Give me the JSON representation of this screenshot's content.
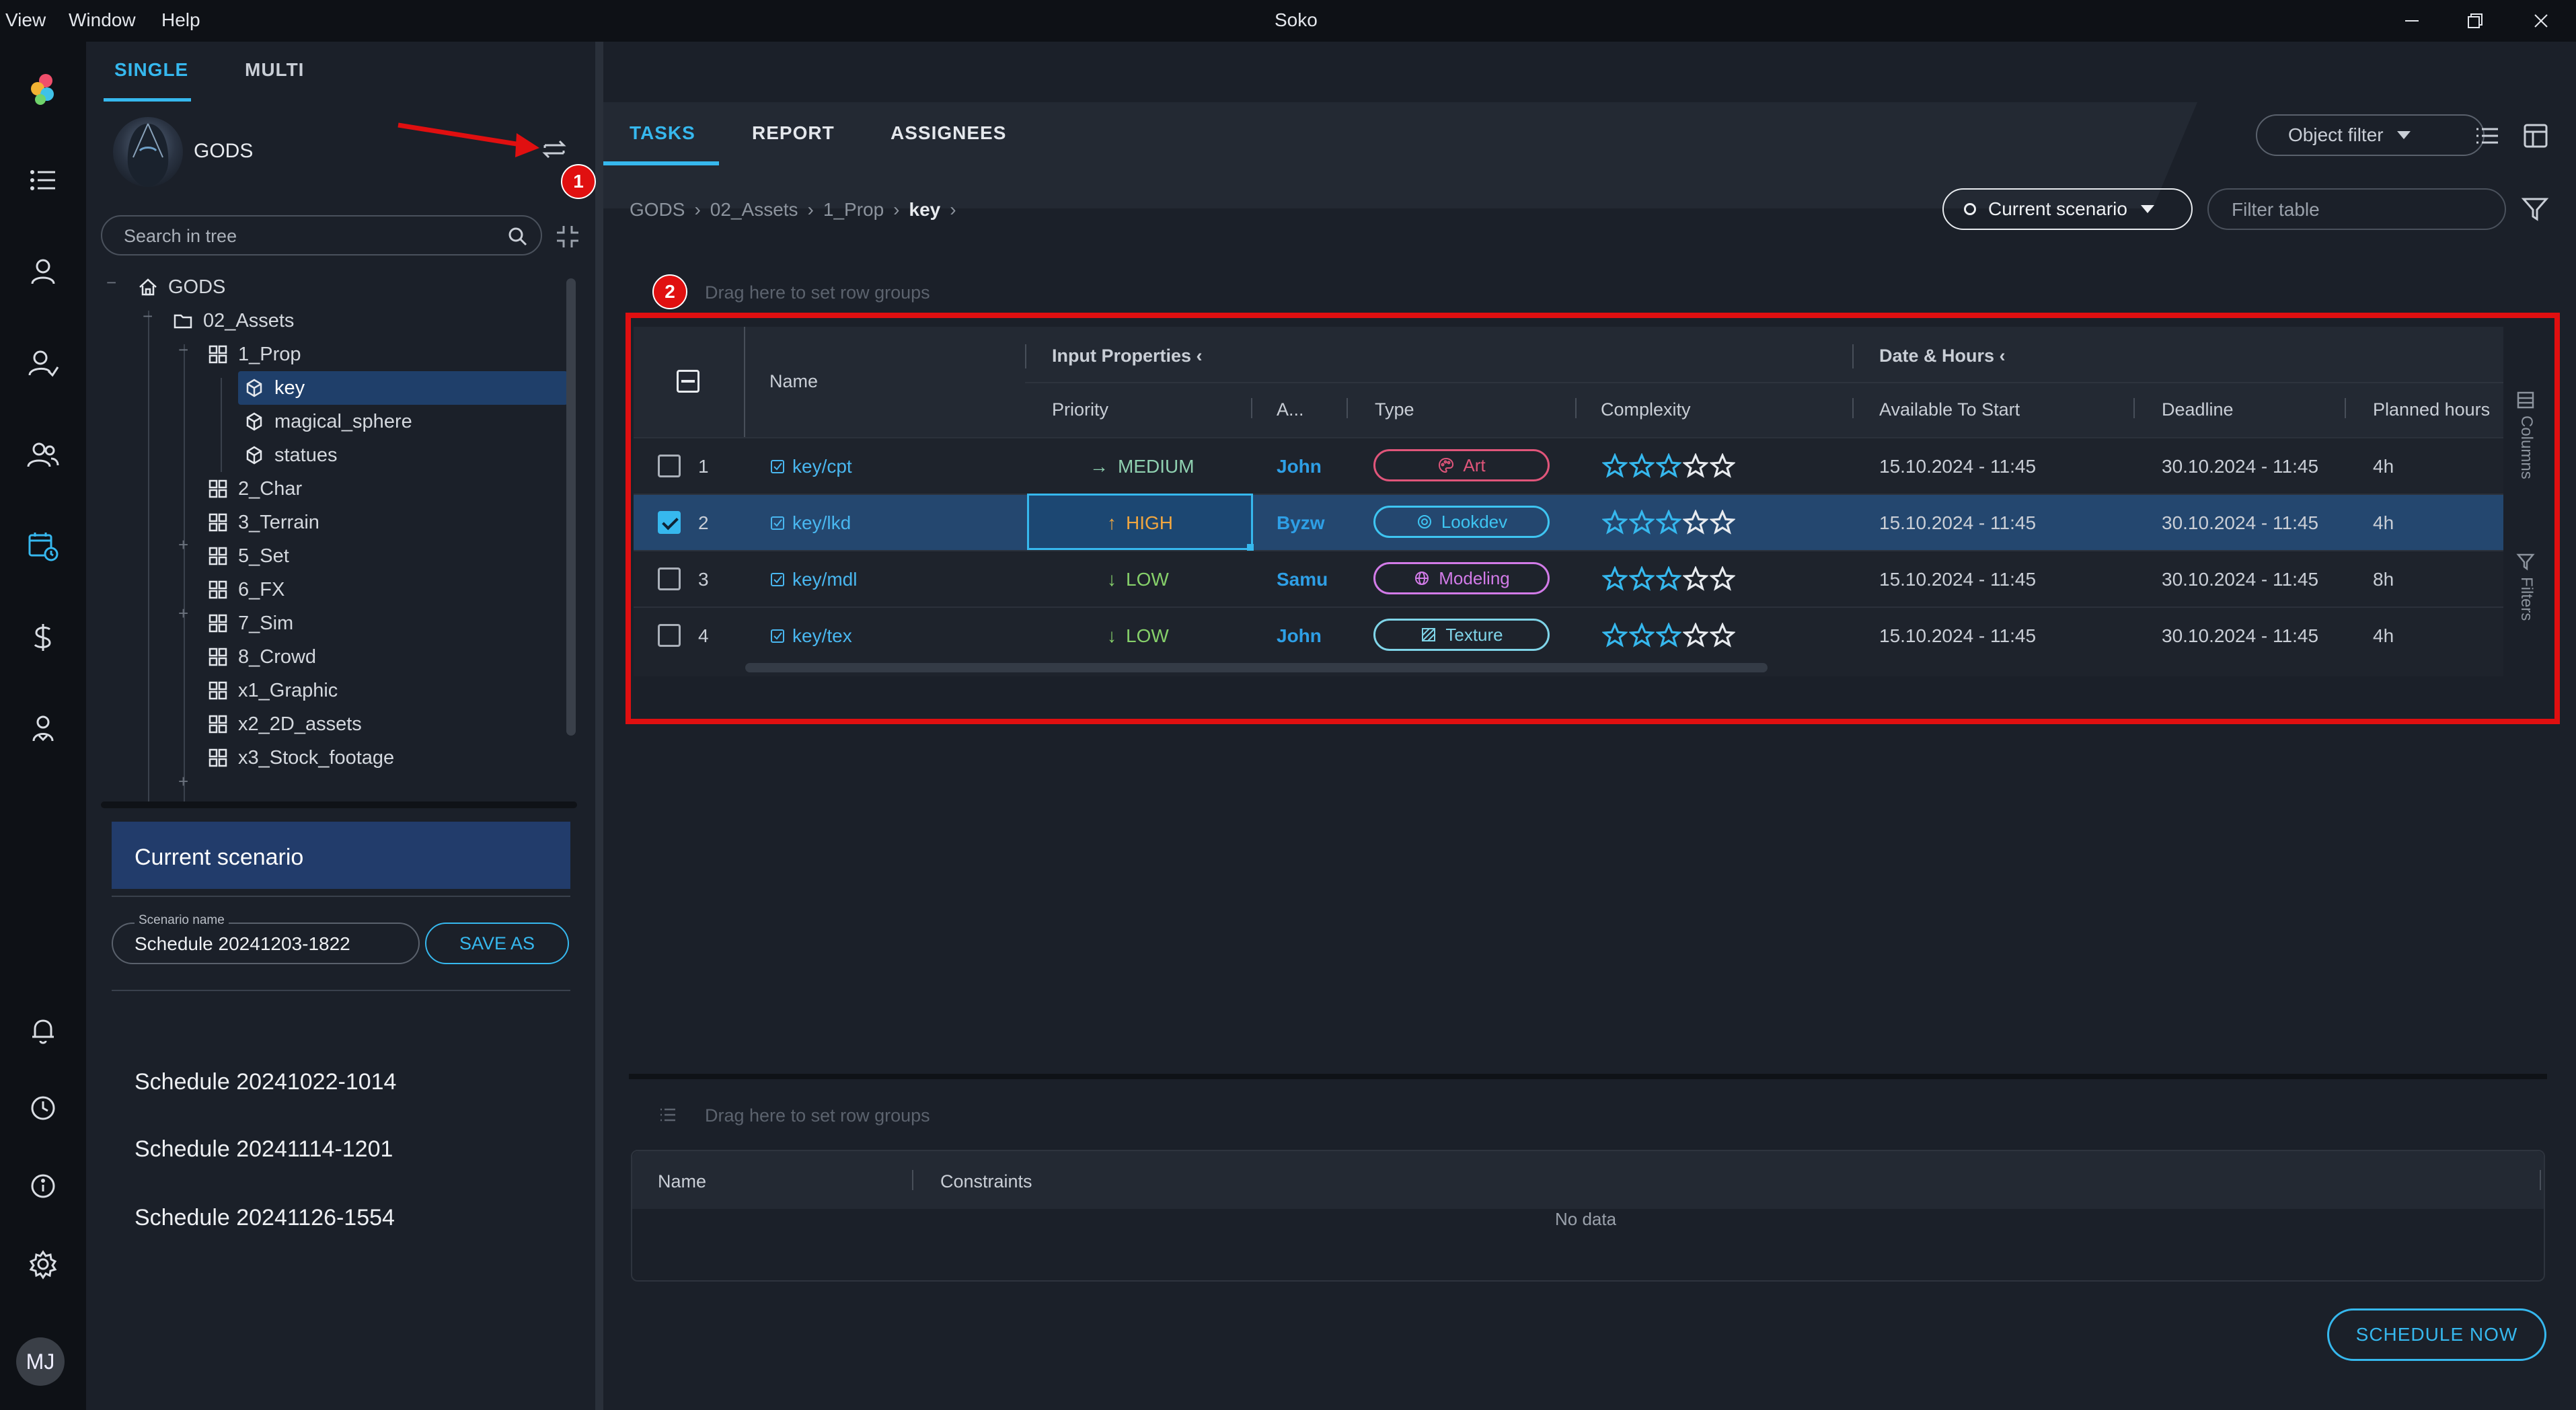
{
  "menubar": {
    "items": [
      "View",
      "Window",
      "Help"
    ],
    "title": "Soko"
  },
  "mode_tabs": {
    "single": "SINGLE",
    "multi": "MULTI"
  },
  "project": {
    "name": "GODS"
  },
  "search": {
    "placeholder": "Search in tree"
  },
  "tree": [
    {
      "label": "GODS",
      "icon": "home-icon",
      "level": 0
    },
    {
      "label": "02_Assets",
      "icon": "folder-icon",
      "level": 1
    },
    {
      "label": "1_Prop",
      "icon": "grid-icon",
      "level": 2
    },
    {
      "label": "key",
      "icon": "asset-icon",
      "level": 3,
      "selected": true
    },
    {
      "label": "magical_sphere",
      "icon": "asset-icon",
      "level": 3
    },
    {
      "label": "statues",
      "icon": "asset-icon",
      "level": 3
    },
    {
      "label": "2_Char",
      "icon": "grid-icon",
      "level": 2
    },
    {
      "label": "3_Terrain",
      "icon": "grid-icon",
      "level": 2
    },
    {
      "label": "5_Set",
      "icon": "grid-icon",
      "level": 2
    },
    {
      "label": "6_FX",
      "icon": "grid-icon",
      "level": 2
    },
    {
      "label": "7_Sim",
      "icon": "grid-icon",
      "level": 2
    },
    {
      "label": "8_Crowd",
      "icon": "grid-icon",
      "level": 2
    },
    {
      "label": "x1_Graphic",
      "icon": "grid-icon",
      "level": 2
    },
    {
      "label": "x2_2D_assets",
      "icon": "grid-icon",
      "level": 2
    },
    {
      "label": "x3_Stock_footage",
      "icon": "grid-icon",
      "level": 2
    }
  ],
  "scenario": {
    "current_label": "Current scenario",
    "name_label": "Scenario name",
    "name_value": "Schedule 20241203-1822",
    "save_as": "SAVE AS",
    "saved": [
      "Schedule 20241022-1014",
      "Schedule 20241114-1201",
      "Schedule 20241126-1554"
    ]
  },
  "main_tabs": [
    "TASKS",
    "REPORT",
    "ASSIGNEES"
  ],
  "object_filter": "Object filter",
  "breadcrumb": [
    "GODS",
    "02_Assets",
    "1_Prop",
    "key"
  ],
  "scenario_pill": "Current scenario",
  "filter_table": {
    "placeholder": "Filter table"
  },
  "drag_hint": "Drag here to set row groups",
  "badges": {
    "one": "1",
    "two": "2"
  },
  "grid": {
    "groups": {
      "input": "Input Properties",
      "date": "Date & Hours"
    },
    "columns": {
      "name": "Name",
      "priority": "Priority",
      "assignee": "A...",
      "type": "Type",
      "complexity": "Complexity",
      "available": "Available To Start",
      "deadline": "Deadline",
      "planned": "Planned hours"
    },
    "rows": [
      {
        "idx": "1",
        "name": "key/cpt",
        "priority": "MEDIUM",
        "priority_arrow": "→",
        "priority_color": "#8fd0b0",
        "assignee": "John",
        "type": "Art",
        "type_color": "#e0557a",
        "type_icon": "palette-icon",
        "complexity": 3,
        "available": "15.10.2024 - 11:45",
        "deadline": "30.10.2024 - 11:45",
        "planned": "4h",
        "checked": false
      },
      {
        "idx": "2",
        "name": "key/lkd",
        "priority": "HIGH",
        "priority_arrow": "↑",
        "priority_color": "#f0a640",
        "assignee": "Byzw",
        "type": "Lookdev",
        "type_color": "#3ec5f2",
        "type_icon": "lookdev-icon",
        "complexity": 3,
        "available": "15.10.2024 - 11:45",
        "deadline": "30.10.2024 - 11:45",
        "planned": "4h",
        "checked": true
      },
      {
        "idx": "3",
        "name": "key/mdl",
        "priority": "LOW",
        "priority_arrow": "↓",
        "priority_color": "#86d06a",
        "assignee": "Samu",
        "type": "Modeling",
        "type_color": "#d27be8",
        "type_icon": "globe-icon",
        "complexity": 3,
        "available": "15.10.2024 - 11:45",
        "deadline": "30.10.2024 - 11:45",
        "planned": "8h",
        "checked": false
      },
      {
        "idx": "4",
        "name": "key/tex",
        "priority": "LOW",
        "priority_arrow": "↓",
        "priority_color": "#86d06a",
        "assignee": "John",
        "type": "Texture",
        "type_color": "#7fd4e8",
        "type_icon": "hatch-icon",
        "complexity": 3,
        "available": "15.10.2024 - 11:45",
        "deadline": "30.10.2024 - 11:45",
        "planned": "4h",
        "checked": false
      }
    ]
  },
  "side_tools": {
    "columns": "Columns",
    "filters": "Filters"
  },
  "constraints": {
    "name_col": "Name",
    "constraints_col": "Constraints",
    "empty": "No data"
  },
  "schedule_now": "SCHEDULE NOW",
  "user_initials": "MJ",
  "colors": {
    "accent": "#36b8ee",
    "annotation": "#e00f10",
    "selection": "#24476f"
  }
}
